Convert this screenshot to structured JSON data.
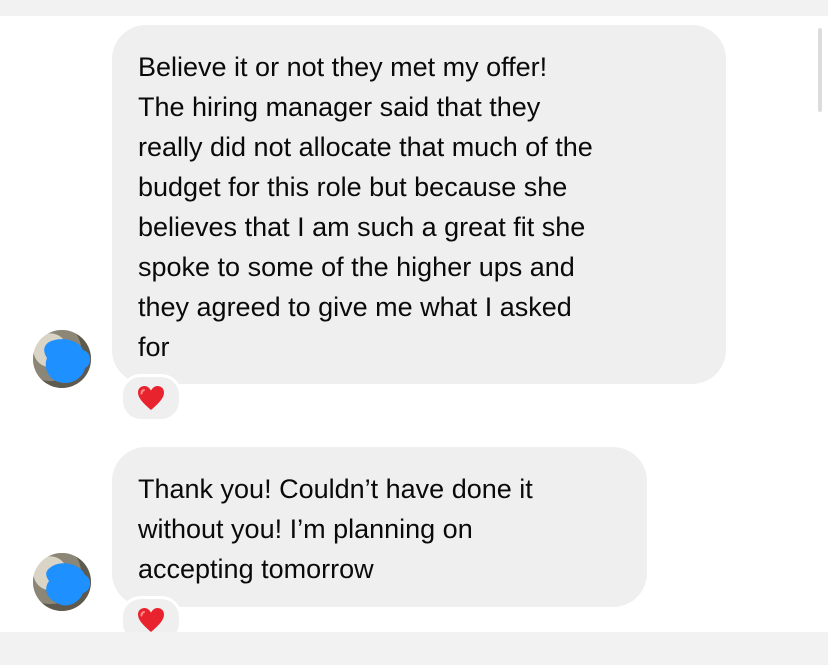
{
  "conversation": {
    "messages": [
      {
        "text": "Believe it or not they met my offer!\nThe hiring manager said that they\nreally did not allocate that much of the\nbudget for this role but because she\nbelieves that I am such a great fit she\nspoke to some of the higher ups and\nthey agreed to give me what I asked\nfor",
        "reaction": "heart-icon"
      },
      {
        "text": "Thank you! Couldn’t have done it\nwithout you! I’m planning on\naccepting tomorrow",
        "reaction": "heart-icon"
      }
    ]
  },
  "colors": {
    "bubble": "#efeff0",
    "heart": "#e8232e",
    "redaction": "#1e90ff"
  }
}
